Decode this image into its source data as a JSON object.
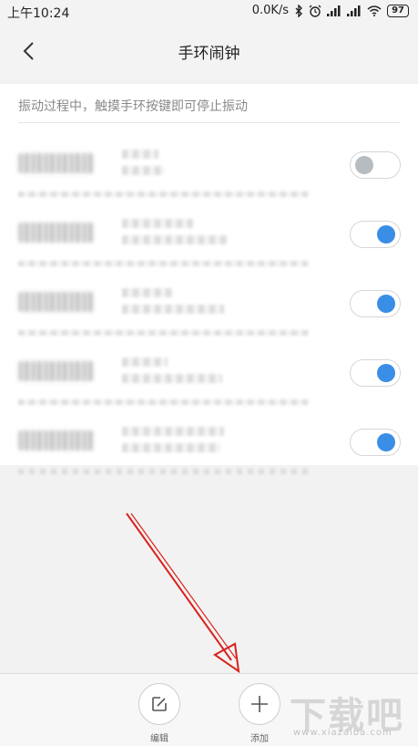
{
  "status_bar": {
    "time": "上午10:24",
    "network_speed": "0.0K/s",
    "battery": "97",
    "icons": [
      "bluetooth-icon",
      "alarm-clock-icon",
      "signal-icon",
      "signal-icon",
      "wifi-icon",
      "battery-icon"
    ]
  },
  "header": {
    "title": "手环闹钟",
    "back_icon": "chevron-left-icon"
  },
  "hint": "振动过程中，触摸手环按键即可停止振动",
  "alarms": [
    {
      "enabled": false
    },
    {
      "enabled": true
    },
    {
      "enabled": true
    },
    {
      "enabled": true
    },
    {
      "enabled": true
    }
  ],
  "bottom_bar": {
    "edit_label": "编辑",
    "add_label": "添加",
    "edit_icon": "edit-icon",
    "add_icon": "plus-icon"
  },
  "watermark": {
    "brand": "下载吧",
    "url": "www.xiazaiba.com"
  },
  "colors": {
    "toggle_on": "#3a8ee6",
    "toggle_off": "#b7bcc1",
    "arrow": "#d9221c"
  }
}
